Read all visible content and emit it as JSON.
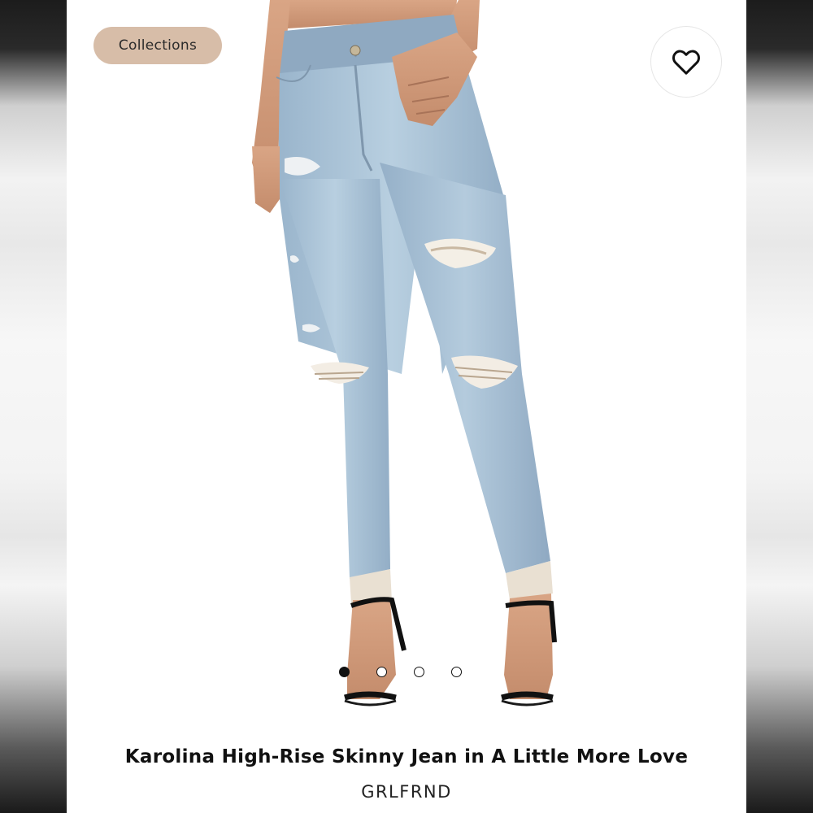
{
  "collections_label": "Collections",
  "favorite": {
    "icon": "heart-outline-icon"
  },
  "gallery": {
    "image_count": 4,
    "active_index": 0
  },
  "product": {
    "title": "Karolina High-Rise Skinny Jean in A Little More Love",
    "brand": "GRLFRND"
  },
  "colors": {
    "chip_background": "#d7bda8",
    "denim": "#a9c3d8",
    "text": "#111111"
  }
}
